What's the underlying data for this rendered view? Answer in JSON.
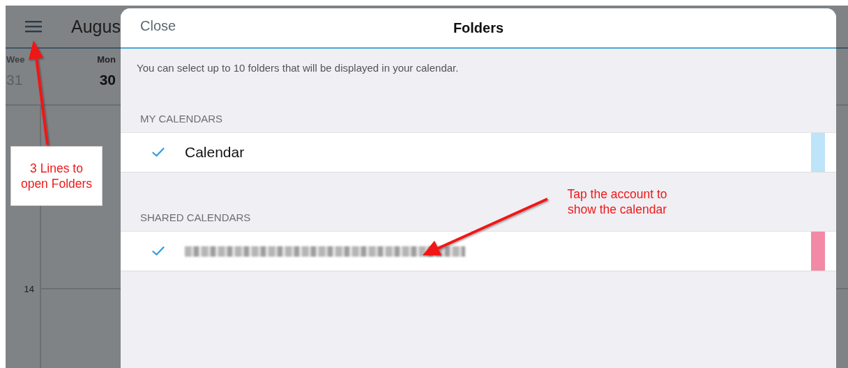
{
  "background_app": {
    "month_title": "Augus",
    "day_columns": [
      {
        "label": "Wee",
        "date": "31",
        "today": false
      },
      {
        "label": "Mon",
        "date": "30",
        "today": true
      }
    ],
    "hour_label": "14"
  },
  "dialog": {
    "close": "Close",
    "title": "Folders",
    "info": "You can select up to 10 folders that will be displayed in your calendar.",
    "sections": [
      {
        "heading": "MY CALENDARS",
        "items": [
          {
            "kind": "name",
            "label": "Calendar",
            "checked": true,
            "color": "#bde4f8"
          }
        ]
      },
      {
        "heading": "SHARED CALENDARS",
        "items": [
          {
            "kind": "redacted",
            "checked": true,
            "color": "#f28aa6"
          }
        ]
      }
    ]
  },
  "annotations": [
    {
      "text": "3 Lines to\nopen Folders",
      "boxed": true
    },
    {
      "text": "Tap the account to\nshow the calendar",
      "boxed": false
    }
  ]
}
